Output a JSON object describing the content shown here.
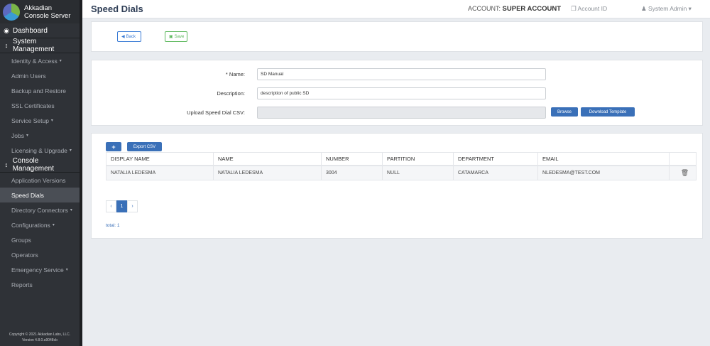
{
  "brand": {
    "line1": "Akkadian",
    "line2": "Console Server"
  },
  "sidebar": {
    "dashboard": "Dashboard",
    "system_management": "System Management",
    "system_items": [
      {
        "label": "Identity & Access",
        "caret": "▾"
      },
      {
        "label": "Admin Users",
        "caret": ""
      },
      {
        "label": "Backup and Restore",
        "caret": ""
      },
      {
        "label": "SSL Certificates",
        "caret": ""
      },
      {
        "label": "Service Setup",
        "caret": "▾"
      },
      {
        "label": "Jobs",
        "caret": "▾"
      },
      {
        "label": "Licensing & Upgrade",
        "caret": "▾"
      }
    ],
    "console_management": "Console Management",
    "console_items": [
      {
        "label": "Application Versions",
        "caret": ""
      },
      {
        "label": "Speed Dials",
        "caret": ""
      },
      {
        "label": "Directory Connectors",
        "caret": "▾"
      },
      {
        "label": "Configurations",
        "caret": "▾"
      },
      {
        "label": "Groups",
        "caret": ""
      },
      {
        "label": "Operators",
        "caret": ""
      },
      {
        "label": "Emergency Service",
        "caret": "▾"
      },
      {
        "label": "Reports",
        "caret": ""
      }
    ],
    "copyright_line1": "Copyright © 2021 Akkadian Labs, LLC.",
    "copyright_line2": "Version 4.8.0.a9048cb"
  },
  "header": {
    "title": "Speed Dials",
    "account_label": "ACCOUNT:",
    "account_value": "SUPER ACCOUNT",
    "account_id": "Account ID",
    "user": "System Admin ▾"
  },
  "toolbar": {
    "back": "Back",
    "save": "Save"
  },
  "form": {
    "name_label": "* Name:",
    "name_value": "SD Manual",
    "description_label": "Description:",
    "description_value": "description of public SD",
    "upload_label": "Upload Speed Dial CSV:",
    "upload_value": "",
    "browse": "Browse",
    "download_template": "Download Template"
  },
  "table": {
    "add_label": "+",
    "export_label": "Export CSV",
    "columns": [
      "DISPLAY NAME",
      "NAME",
      "NUMBER",
      "PARTITION",
      "DEPARTMENT",
      "EMAIL"
    ],
    "rows": [
      [
        "NATALIA LEDESMA",
        "NATALIA LEDESMA",
        "3004",
        "NULL",
        "CATAMARCA",
        "NLEDESMA@TEST.COM"
      ]
    ]
  },
  "pagination": {
    "prev": "‹",
    "page": "1",
    "next": "›"
  },
  "total": "total: 1",
  "colors": {
    "sidebar_bg": "#2f3237",
    "accent": "#3a70b8",
    "save_green": "#5cb85c",
    "title": "#2f3e56"
  }
}
